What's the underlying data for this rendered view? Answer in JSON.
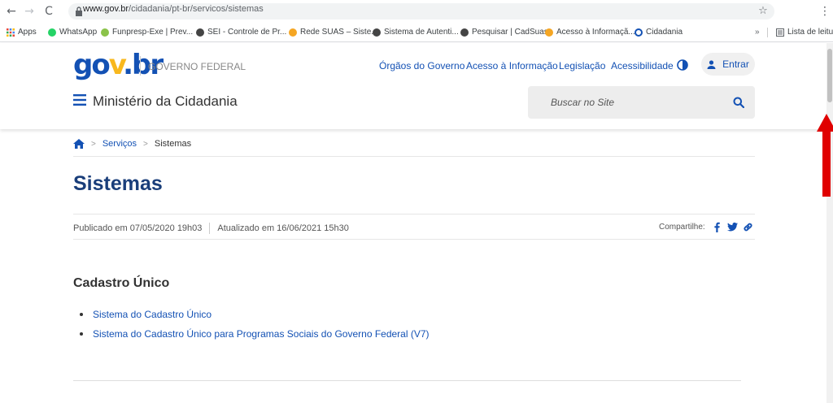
{
  "browser": {
    "url_host": "www.gov.br",
    "url_path": "/cidadania/pt-br/servicos/sistemas",
    "bookmarks": [
      {
        "label": "Apps",
        "color": "#4285f4"
      },
      {
        "label": "WhatsApp",
        "color": "#25d366"
      },
      {
        "label": "Funpresp-Exe | Prev...",
        "color": "#8bc34a"
      },
      {
        "label": "SEI - Controle de Pr...",
        "color": "#444444"
      },
      {
        "label": "Rede SUAS – Siste...",
        "color": "#f5a623"
      },
      {
        "label": "Sistema de Autenti...",
        "color": "#444444"
      },
      {
        "label": "Pesquisar | CadSuas",
        "color": "#444444"
      },
      {
        "label": "Acesso à Informaçã...",
        "color": "#f5a623"
      },
      {
        "label": "Cidadania",
        "color": "#1351b4"
      }
    ],
    "reading_list": "Lista de leitura"
  },
  "header": {
    "logo": {
      "part1": "go",
      "part2": "v",
      "part3": ".br"
    },
    "gov_label": "GOVERNO FEDERAL",
    "links": [
      "Órgãos do Governo",
      "Acesso à Informação",
      "Legislação",
      "Acessibilidade"
    ],
    "login_label": "Entrar",
    "ministry": "Ministério da Cidadania",
    "search_placeholder": "Buscar no Site"
  },
  "breadcrumb": {
    "items": [
      "Serviços",
      "Sistemas"
    ]
  },
  "page": {
    "title": "Sistemas",
    "published": "Publicado em 07/05/2020 19h03",
    "updated": "Atualizado em 16/06/2021 15h30",
    "share_label": "Compartilhe:",
    "section_title": "Cadastro Único",
    "links": [
      "Sistema do Cadastro Único",
      "Sistema do Cadastro Único para Programas Sociais do Governo Federal (V7)"
    ]
  },
  "colors": {
    "brand_blue": "#1351b4",
    "brand_yellow": "#f8b81e",
    "title_blue": "#1a3e7a",
    "annotation_red": "#e00000"
  },
  "icons": [
    "back-icon",
    "forward-icon",
    "reload-icon",
    "lock-icon",
    "star-icon",
    "menu-icon",
    "home-icon",
    "contrast-icon",
    "user-icon",
    "hamburger-icon",
    "search-icon",
    "facebook-icon",
    "twitter-icon",
    "link-icon"
  ]
}
